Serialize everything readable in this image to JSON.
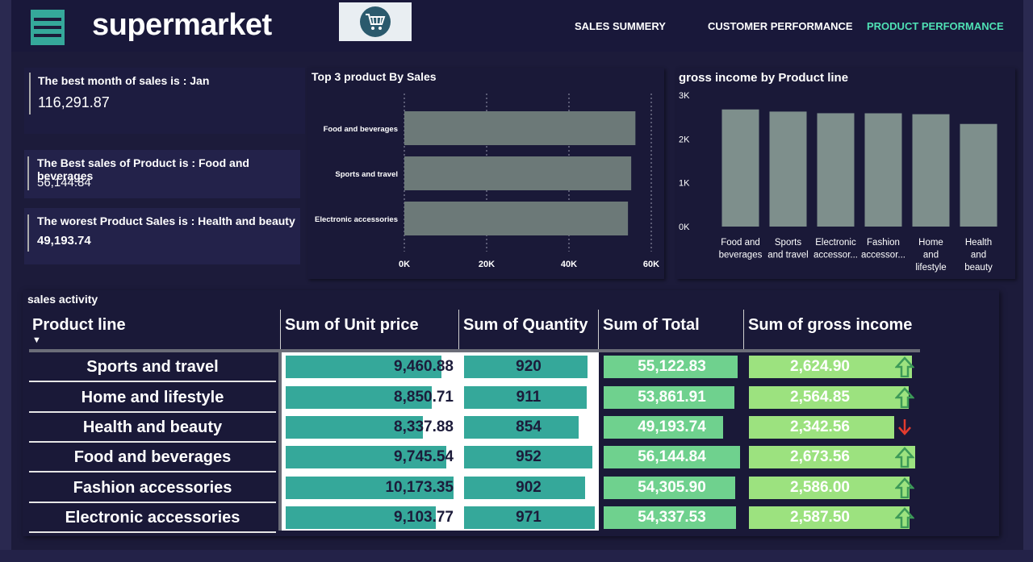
{
  "app": {
    "title": "supermarket"
  },
  "nav": [
    "SALES SUMMERY",
    "CUSTOMER PERFORMANCE",
    "PRODUCT PERFORMANCE"
  ],
  "colors": {
    "accent": "#4fe0b4",
    "bg": "#1c1b3a",
    "teal": "#35a89a",
    "green": "#6fd18e",
    "lightgreen": "#9ce27f",
    "gray_bar": "#6c7978",
    "gray_col": "#7e8f8c",
    "up": "#3d9a58",
    "down": "#e23b2e"
  },
  "kpis": [
    {
      "label": "The best month of sales is : Jan",
      "value": "116,291.87"
    },
    {
      "label": "The Best sales of Product is : Food and beverages",
      "value": "56,144.84"
    },
    {
      "label": "The worest Product Sales is : Health and beauty",
      "value": "49,193.74"
    }
  ],
  "chart_data": [
    {
      "type": "bar",
      "orientation": "horizontal",
      "title": "Top 3 product By Sales",
      "categories": [
        "Food and beverages",
        "Sports and travel",
        "Electronic accessories"
      ],
      "values": [
        56144.84,
        55122.83,
        54337.53
      ],
      "xlim": [
        0,
        60000
      ],
      "ticks": [
        "0K",
        "20K",
        "40K",
        "60K"
      ],
      "tick_values": [
        0,
        20000,
        40000,
        60000
      ],
      "grid": true
    },
    {
      "type": "bar",
      "title": "gross income by Product line",
      "categories": [
        [
          "Food and",
          "beverages"
        ],
        [
          "Sports",
          "and travel"
        ],
        [
          "Electronic",
          "accessor..."
        ],
        [
          "Fashion",
          "accessor..."
        ],
        [
          "Home",
          "and",
          "lifestyle"
        ],
        [
          "Health",
          "and",
          "beauty"
        ]
      ],
      "values": [
        2673.56,
        2624.9,
        2587.5,
        2586.0,
        2564.85,
        2342.56
      ],
      "ylim": [
        0,
        3000
      ],
      "ticks": [
        "0K",
        "1K",
        "2K",
        "3K"
      ],
      "tick_values": [
        0,
        1000,
        2000,
        3000
      ],
      "grid": false
    }
  ],
  "table": {
    "section_title": "sales activity",
    "headers": [
      "Product line",
      "Sum of Unit price",
      "Sum of Quantity",
      "Sum of Total",
      "Sum of gross income"
    ],
    "sort_indicator": "▼",
    "rows": [
      {
        "product": "Sports and travel",
        "unit_price": "9,460.88",
        "unit_price_v": 9460.88,
        "quantity": "920",
        "quantity_v": 920,
        "total": "55,122.83",
        "total_v": 55122.83,
        "gross": "2,624.90",
        "gross_v": 2624.9,
        "trend": "up"
      },
      {
        "product": "Home and lifestyle",
        "unit_price": "8,850.71",
        "unit_price_v": 8850.71,
        "quantity": "911",
        "quantity_v": 911,
        "total": "53,861.91",
        "total_v": 53861.91,
        "gross": "2,564.85",
        "gross_v": 2564.85,
        "trend": "up"
      },
      {
        "product": "Health and beauty",
        "unit_price": "8,337.88",
        "unit_price_v": 8337.88,
        "quantity": "854",
        "quantity_v": 854,
        "total": "49,193.74",
        "total_v": 49193.74,
        "gross": "2,342.56",
        "gross_v": 2342.56,
        "trend": "down"
      },
      {
        "product": "Food and beverages",
        "unit_price": "9,745.54",
        "unit_price_v": 9745.54,
        "quantity": "952",
        "quantity_v": 952,
        "total": "56,144.84",
        "total_v": 56144.84,
        "gross": "2,673.56",
        "gross_v": 2673.56,
        "trend": "up"
      },
      {
        "product": "Fashion accessories",
        "unit_price": "10,173.35",
        "unit_price_v": 10173.35,
        "quantity": "902",
        "quantity_v": 902,
        "total": "54,305.90",
        "total_v": 54305.9,
        "gross": "2,586.00",
        "gross_v": 2586.0,
        "trend": "up"
      },
      {
        "product": "Electronic accessories",
        "unit_price": "9,103.77",
        "unit_price_v": 9103.77,
        "quantity": "971",
        "quantity_v": 971,
        "total": "54,337.53",
        "total_v": 54337.53,
        "gross": "2,587.50",
        "gross_v": 2587.5,
        "trend": "up"
      }
    ]
  }
}
